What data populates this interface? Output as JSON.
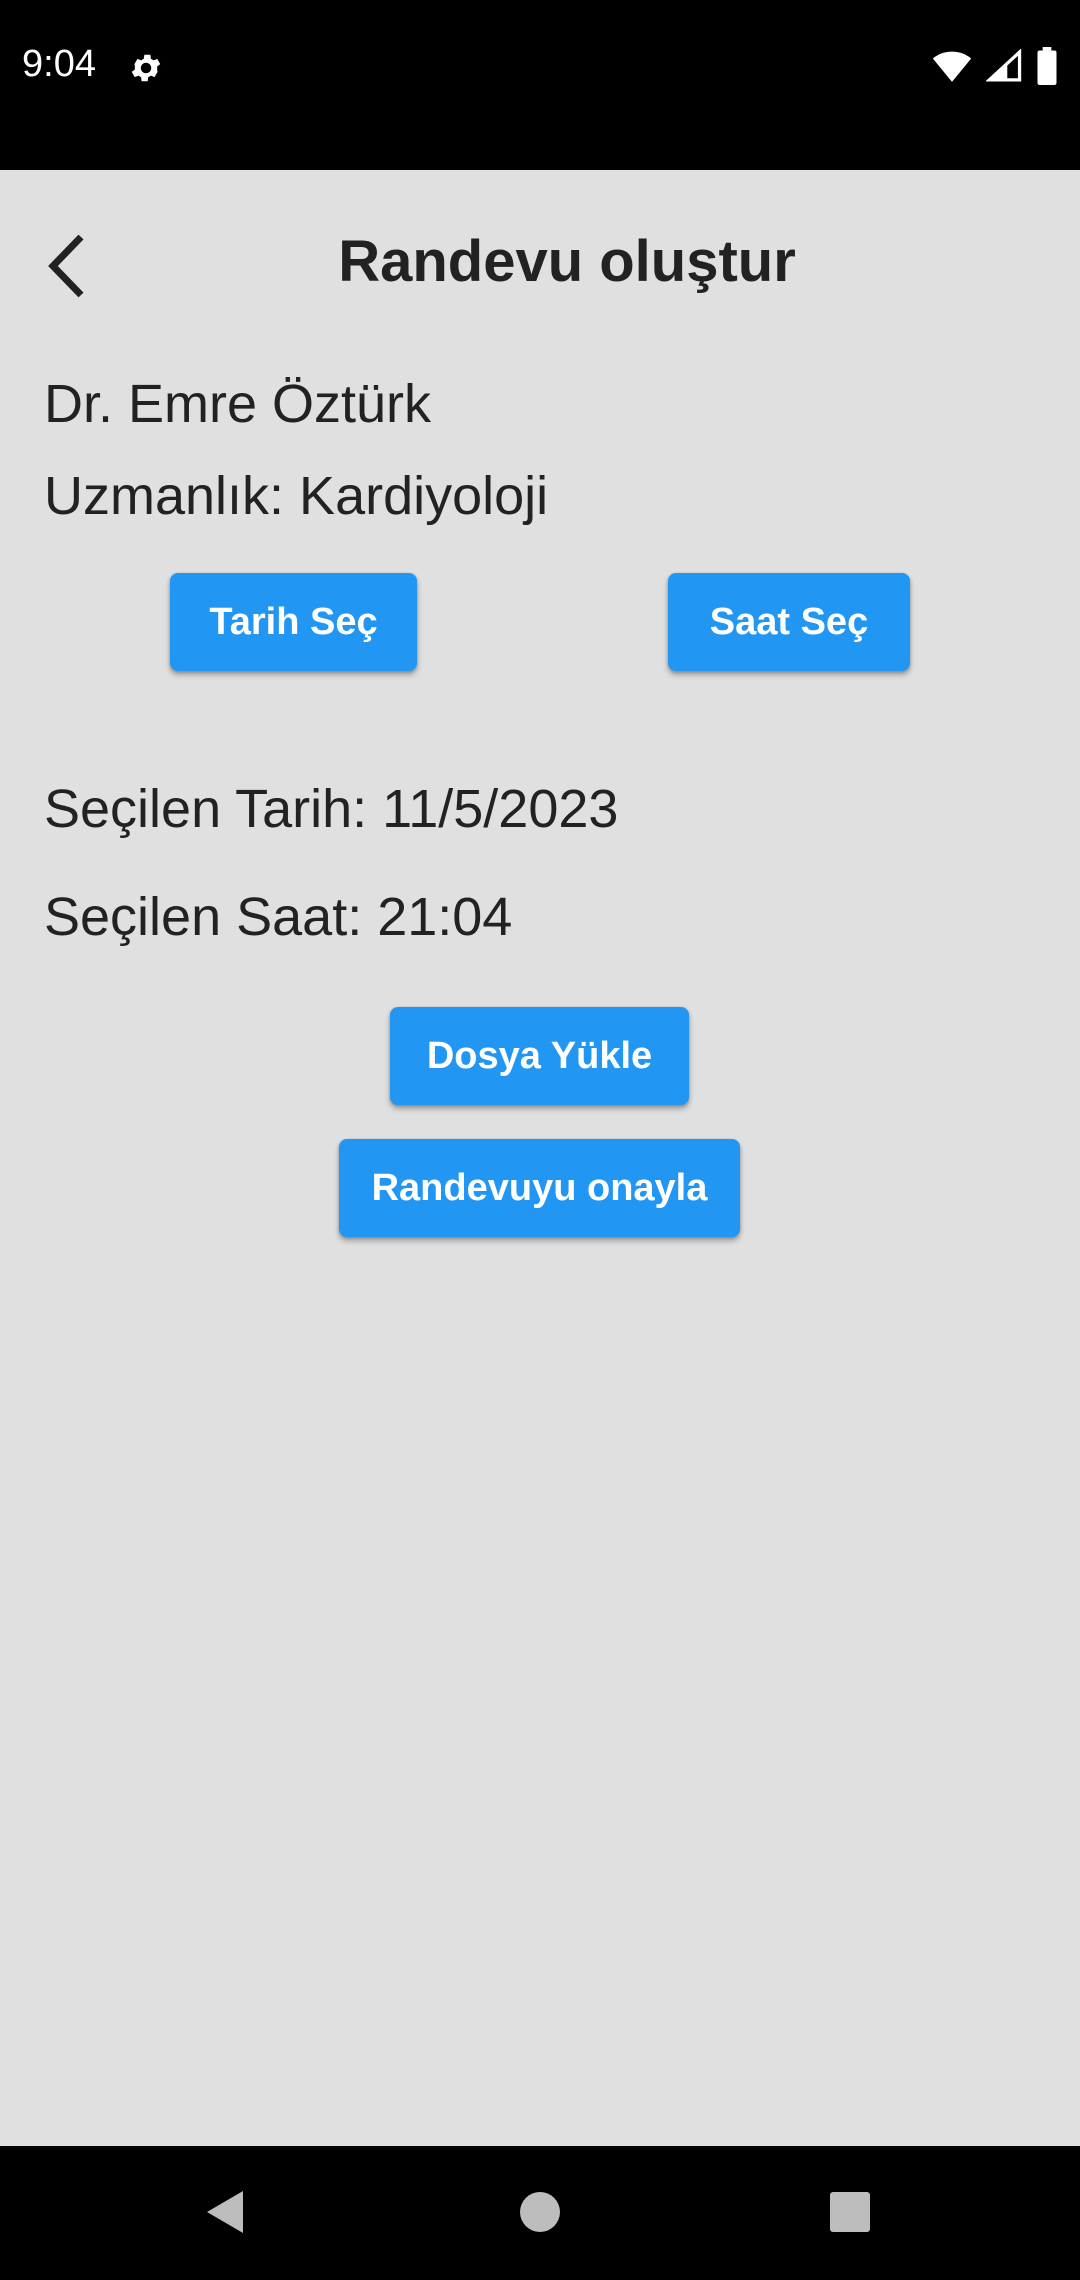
{
  "status_bar": {
    "time": "9:04",
    "icons": [
      "gear-icon",
      "wifi-icon",
      "cellular-signal-icon",
      "battery-icon"
    ]
  },
  "header": {
    "title": "Randevu oluştur",
    "back_icon": "chevron-left-icon"
  },
  "doctor": {
    "name": "Dr. Emre Öztürk",
    "specialty": "Uzmanlık: Kardiyoloji"
  },
  "buttons": {
    "select_date": "Tarih Seç",
    "select_time": "Saat Seç",
    "upload_file": "Dosya Yükle",
    "confirm": "Randevuyu onayla"
  },
  "selection": {
    "date_text": "Seçilen Tarih: 11/5/2023",
    "time_text": "Seçilen Saat: 21:04"
  },
  "colors": {
    "accent": "#2196f3",
    "background": "#e0e0e0",
    "system_bars": "#000000",
    "text": "#222222"
  },
  "nav_bar": {
    "icons": [
      "back-triangle-icon",
      "home-circle-icon",
      "recents-square-icon"
    ]
  }
}
